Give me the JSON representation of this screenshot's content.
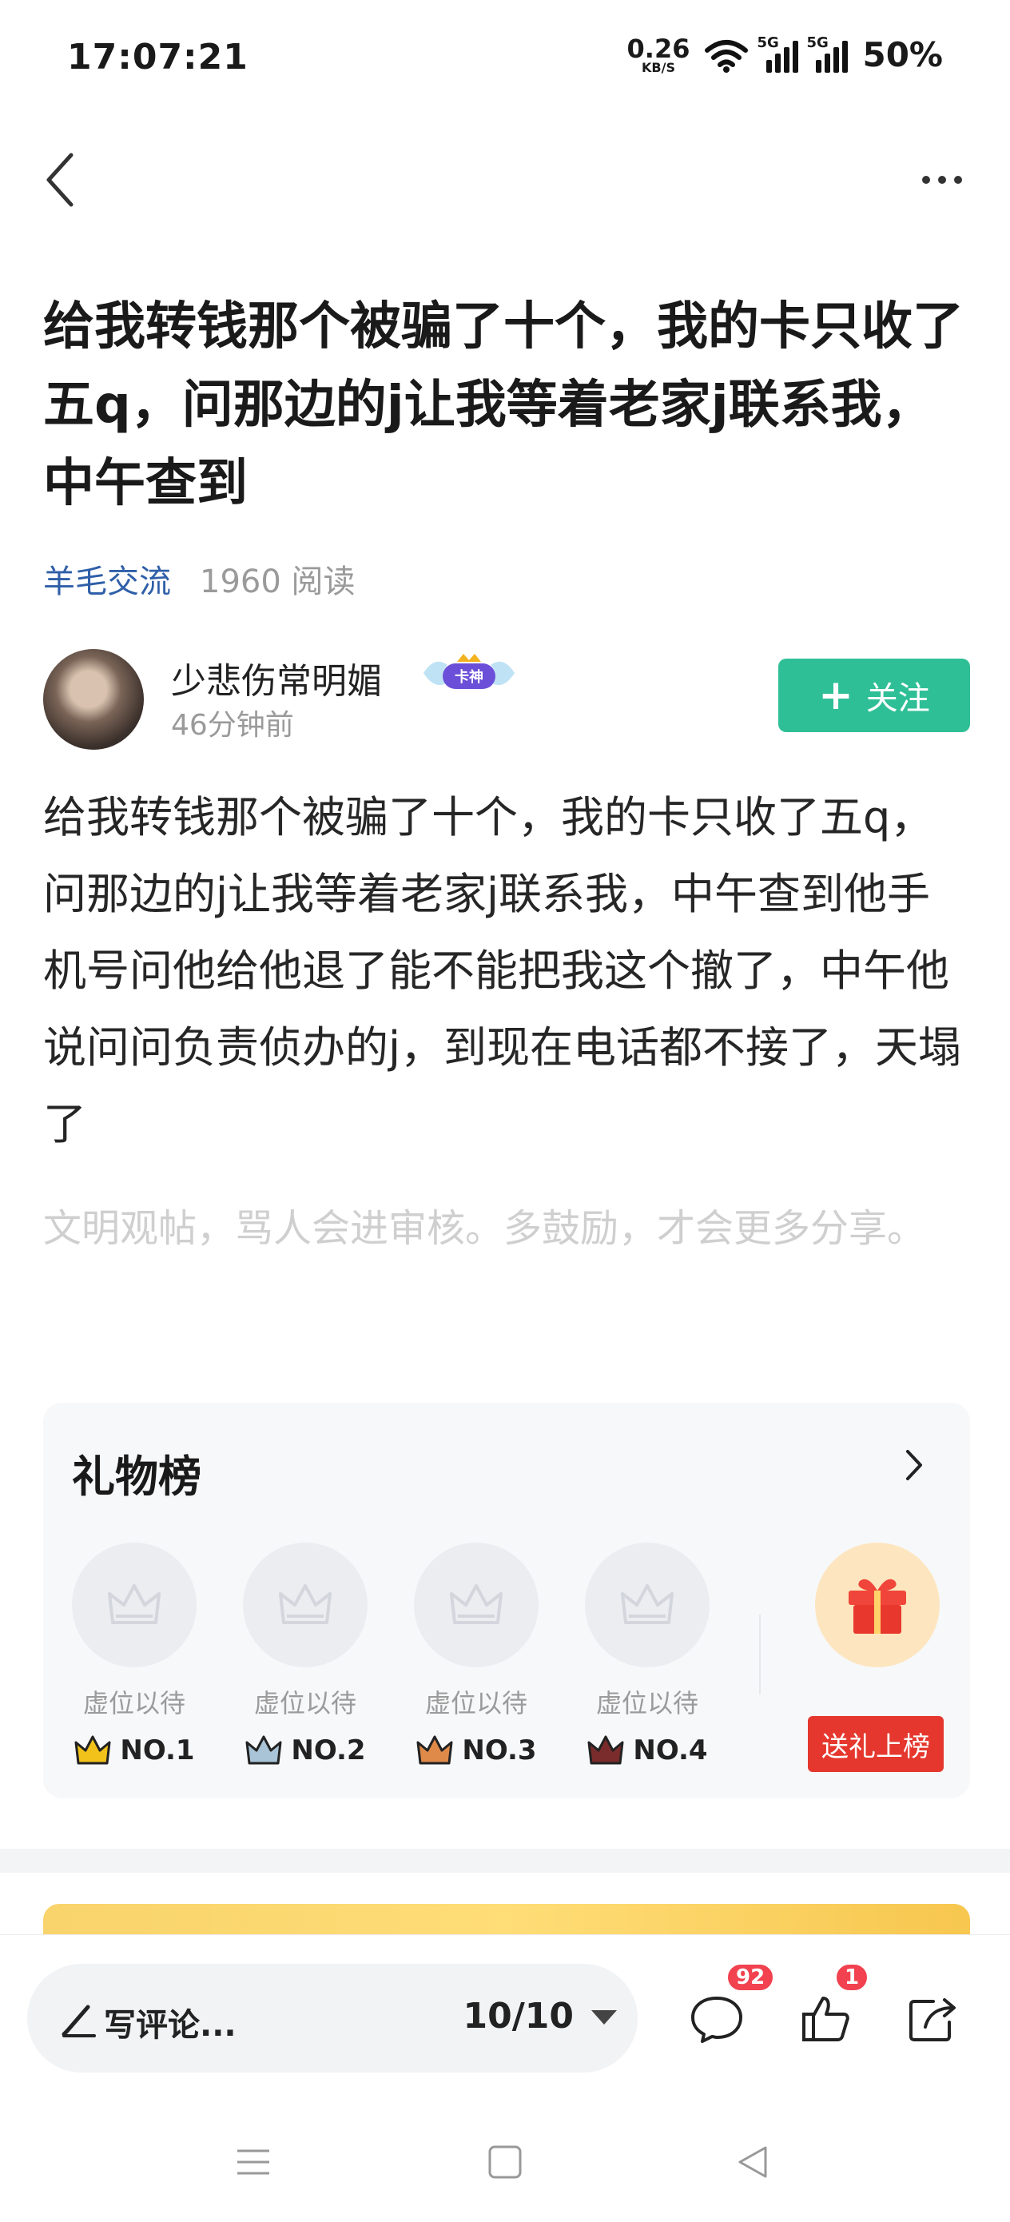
{
  "status": {
    "time": "17:07:21",
    "net_speed_value": "0.26",
    "net_speed_unit": "KB/S",
    "sim1_label": "5G",
    "sim2_label": "5G",
    "battery": "50%"
  },
  "nav": {
    "back_icon": "chevron-left-icon",
    "more_icon": "more-dots-icon"
  },
  "post": {
    "title": "给我转钱那个被骗了十个，我的卡只收了五q，问那边的j让我等着老家j联系我，中午查到",
    "category": "羊毛交流",
    "reads": "1960 阅读",
    "author_name": "少悲伤常明媚",
    "author_badge": "卡神",
    "posted_time": "46分钟前",
    "follow_label": "关注",
    "body": "给我转钱那个被骗了十个，我的卡只收了五q，问那边的j让我等着老家j联系我，中午查到他手机号问他给他退了能不能把我这个撤了，中午他说问问负责侦办的j，到现在电话都不接了，天塌了",
    "civility_hint": "文明观帖，骂人会进审核。多鼓励，才会更多分享。"
  },
  "gift_board": {
    "title": "礼物榜",
    "slots": [
      {
        "label": "虚位以待",
        "rank": "NO.1",
        "crown_color": "#f2c21b"
      },
      {
        "label": "虚位以待",
        "rank": "NO.2",
        "crown_color": "#a9c4d6"
      },
      {
        "label": "虚位以待",
        "rank": "NO.3",
        "crown_color": "#e08a4a"
      },
      {
        "label": "虚位以待",
        "rank": "NO.4",
        "crown_color": "#7a2b2b"
      }
    ],
    "send_label": "送礼上榜"
  },
  "bottom": {
    "comment_placeholder": "写评论...",
    "page_indicator": "10/10",
    "comment_count": "92",
    "like_count": "1"
  },
  "colors": {
    "accent_green": "#2fbf97",
    "category_blue": "#2f5fa8",
    "badge_red": "#f2414f",
    "gift_red": "#e5372d"
  }
}
